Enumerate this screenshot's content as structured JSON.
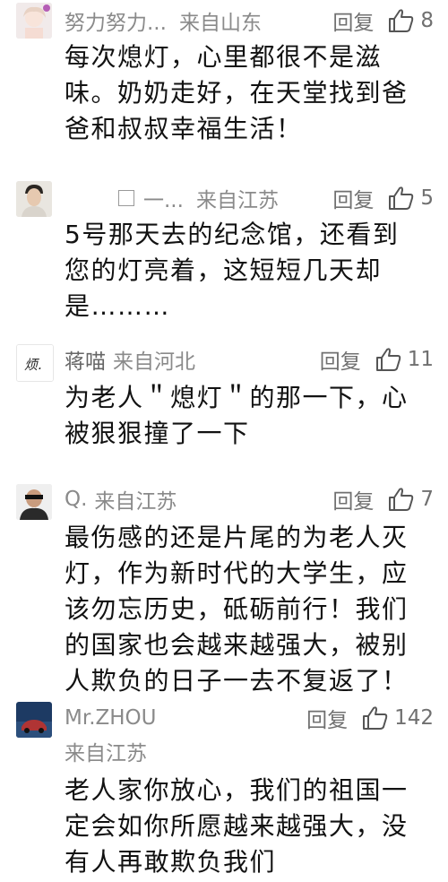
{
  "comments": [
    {
      "name": "努力努力...",
      "location": "来自山东",
      "reply_label": "回复",
      "likes": "8",
      "text": "每次熄灯，心里都很不是滋\n味。奶奶走好，在天堂找到爸\n爸和叔叔幸福生活！"
    },
    {
      "name": "一...",
      "location": "来自江苏",
      "reply_label": "回复",
      "likes": "5",
      "text": "5号那天去的纪念馆，还看到\n您的灯亮着，这短短几天却\n是………"
    },
    {
      "name": "蒋喵",
      "location": "来自河北",
      "reply_label": "回复",
      "likes": "11",
      "text": "为老人＂熄灯＂的那一下，心\n被狠狠撞了一下"
    },
    {
      "name": "Q.",
      "location": "来自江苏",
      "reply_label": "回复",
      "likes": "7",
      "text": "最伤感的还是片尾的为老人灭\n灯，作为新时代的大学生，应\n该勿忘历史，砥砺前行！我们\n的国家也会越来越强大，被别\n人欺负的日子一去不复返了！"
    },
    {
      "name": "Mr.ZHOU",
      "location": "来自江苏",
      "reply_label": "回复",
      "likes": "142",
      "text": "老人家你放心，我们的祖国一\n定会如你所愿越来越强大，没\n有人再敢欺负我们"
    }
  ],
  "avatar_logo_text": "烦.",
  "colors": {
    "meta_gray": "#8a8a8a",
    "text": "#121212",
    "background": "#ffffff"
  }
}
